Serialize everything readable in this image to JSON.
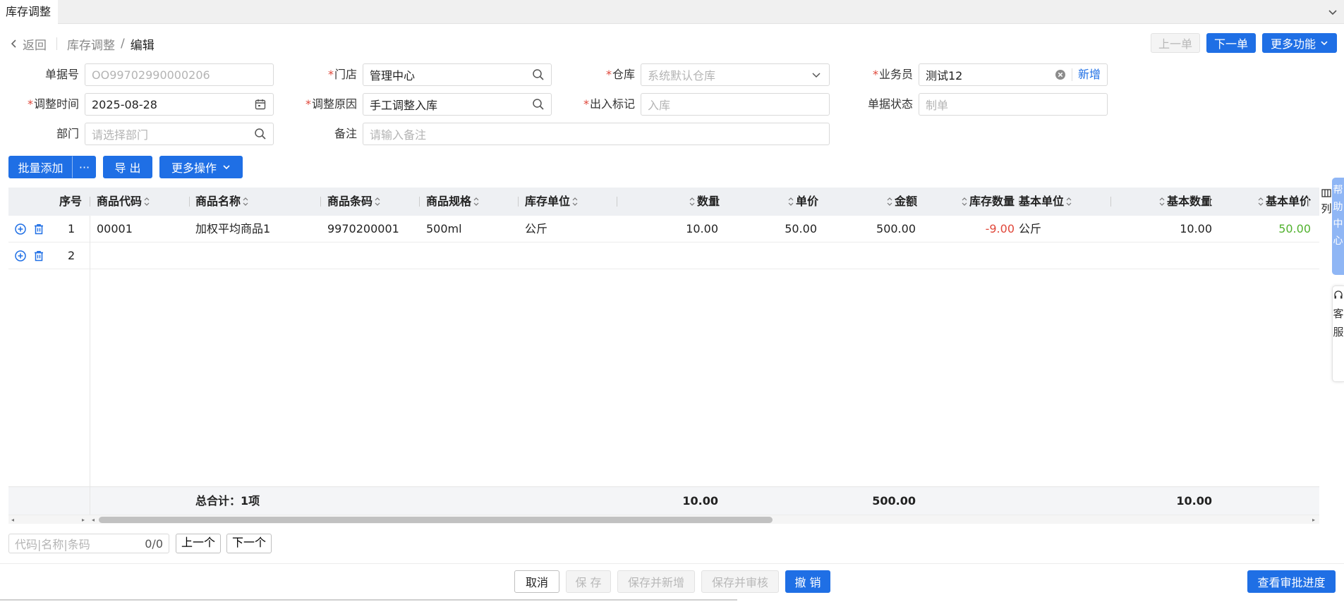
{
  "tabbar": {
    "active_tab": "库存调整"
  },
  "breadcrumb": {
    "back": "返回",
    "parent": "库存调整",
    "separator": "/",
    "current": "编辑"
  },
  "top_actions": {
    "prev": "上一单",
    "next": "下一单",
    "more": "更多功能"
  },
  "form": {
    "doc_no": {
      "label": "单据号",
      "placeholder": "OO99702990000206"
    },
    "store": {
      "label": "门店",
      "value": "管理中心"
    },
    "warehouse": {
      "label": "仓库",
      "placeholder": "系统默认仓库"
    },
    "salesman": {
      "label": "业务员",
      "value": "测试12",
      "add": "新增"
    },
    "adjust_time": {
      "label": "调整时间",
      "value": "2025-08-28"
    },
    "adjust_reason": {
      "label": "调整原因",
      "value": "手工调整入库"
    },
    "io_flag": {
      "label": "出入标记",
      "placeholder": "入库"
    },
    "doc_status": {
      "label": "单据状态",
      "placeholder": "制单"
    },
    "dept": {
      "label": "部门",
      "placeholder": "请选择部门"
    },
    "remark": {
      "label": "备注",
      "placeholder": "请输入备注"
    }
  },
  "toolbar": {
    "batch_add": "批量添加",
    "batch_more": "···",
    "export": "导 出",
    "more_ops": "更多操作"
  },
  "table": {
    "headers": {
      "seq": "序号",
      "code": "商品代码",
      "name": "商品名称",
      "barcode": "商品条码",
      "spec": "商品规格",
      "unit": "库存单位",
      "qty": "数量",
      "price": "单价",
      "amount": "金额",
      "stock_qty": "库存数量",
      "base_unit": "基本单位",
      "base_qty": "基本数量",
      "base_price": "基本单价"
    },
    "rows": [
      {
        "seq": "1",
        "code": "00001",
        "name": "加权平均商品1",
        "barcode": "9970200001",
        "spec": "500ml",
        "unit": "公斤",
        "qty": "10.00",
        "price": "50.00",
        "amount": "500.00",
        "stock_qty": "-9.00",
        "base_unit": "公斤",
        "base_qty": "10.00",
        "base_price": "50.00"
      },
      {
        "seq": "2"
      }
    ],
    "total": {
      "label": "总合计：1项",
      "qty": "10.00",
      "amount": "500.00",
      "base_qty": "10.00"
    }
  },
  "side": {
    "col_setting": "列",
    "help": [
      "帮",
      "助",
      "中",
      "心"
    ],
    "cs": [
      "客",
      "服"
    ]
  },
  "search": {
    "placeholder": "代码|名称|条码",
    "count": "0/0",
    "prev": "上一个",
    "next": "下一个"
  },
  "footer": {
    "cancel": "取消",
    "save": "保 存",
    "save_new": "保存并新增",
    "save_audit": "保存并审核",
    "revoke": "撤 销",
    "approval": "查看审批进度"
  },
  "colors": {
    "primary": "#1f6fe5",
    "required": "#e0473a",
    "negative": "#e0473a",
    "positive": "#52b22f"
  }
}
